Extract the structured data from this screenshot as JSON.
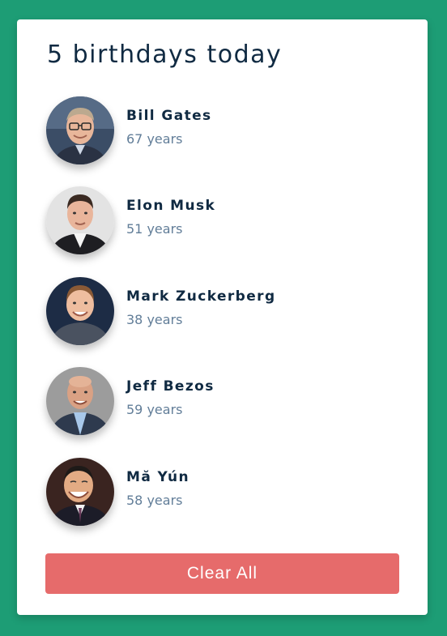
{
  "title": "5 birthdays today",
  "people": [
    {
      "name": "Bill Gates",
      "age": "67 years",
      "avatar": "bill-gates-photo"
    },
    {
      "name": "Elon Musk",
      "age": "51 years",
      "avatar": "elon-musk-photo"
    },
    {
      "name": "Mark Zuckerberg",
      "age": "38 years",
      "avatar": "mark-zuckerberg-photo"
    },
    {
      "name": "Jeff Bezos",
      "age": "59 years",
      "avatar": "jeff-bezos-photo"
    },
    {
      "name": "Mă Yún",
      "age": "58 years",
      "avatar": "ma-yun-photo"
    }
  ],
  "clear_label": "Clear All",
  "colors": {
    "background": "#1d9d75",
    "card": "#ffffff",
    "heading": "#102a42",
    "subtext": "#617d98",
    "button": "#e66b6b"
  }
}
